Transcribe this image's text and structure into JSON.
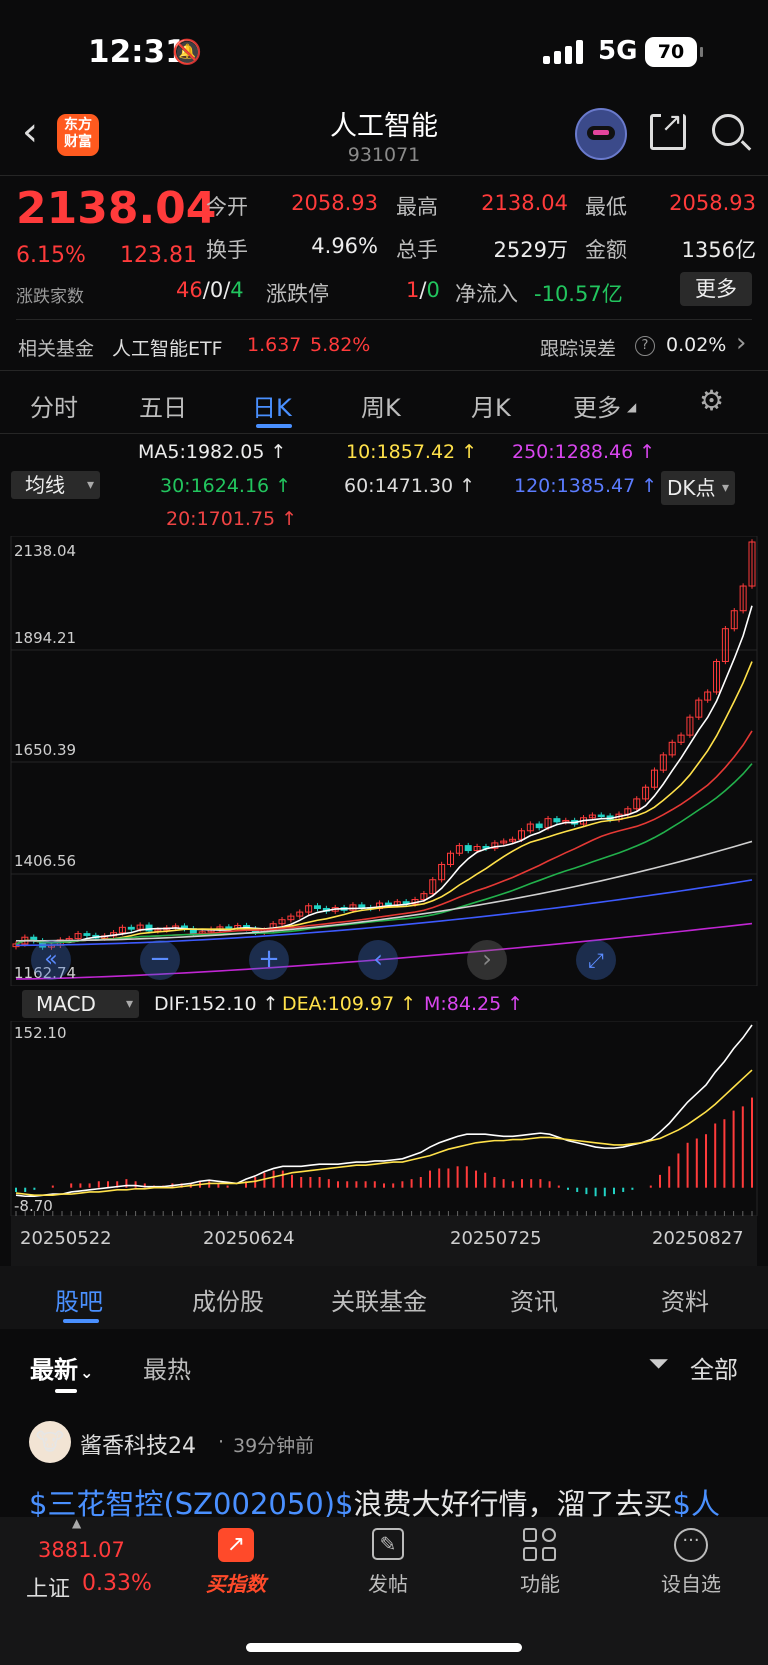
{
  "status_bar": {
    "time": "12:31",
    "network": "5G",
    "battery": "70"
  },
  "header": {
    "logo_text": "东方财富",
    "title": "人工智能",
    "code": "931071"
  },
  "quote": {
    "price": "2138.04",
    "pct": "6.15%",
    "change": "123.81",
    "open_label": "今开",
    "open": "2058.93",
    "high_label": "最高",
    "high": "2138.04",
    "low_label": "最低",
    "low": "2058.93",
    "turnover_label": "换手",
    "turnover": "4.96%",
    "volume_label": "总手",
    "volume": "2529万",
    "amount_label": "金额",
    "amount": "1356亿",
    "breadth_label": "涨跌家数",
    "breadth_up": "46",
    "breadth_flat": "0",
    "breadth_down": "4",
    "limit_label": "涨跌停",
    "limit_up": "1",
    "limit_down": "0",
    "netflow_label": "净流入",
    "netflow": "-10.57亿",
    "more_label": "更多",
    "slash": "/"
  },
  "fund": {
    "label": "相关基金",
    "name": "人工智能ETF",
    "price": "1.637",
    "pct": "5.82%",
    "track_label": "跟踪误差",
    "track_value": "0.02%",
    "help": "?",
    "arrow": "›"
  },
  "chart_tabs": [
    "分时",
    "五日",
    "日K",
    "周K",
    "月K",
    "更多"
  ],
  "active_chart_tab": 2,
  "ma_bar": {
    "select": "均线",
    "dk": "DK点",
    "ma5": "MA5:1982.05 ↑",
    "ma10": "10:1857.42 ↑",
    "ma250": "250:1288.46 ↑",
    "ma30": "30:1624.16 ↑",
    "ma60": "60:1471.30 ↑",
    "ma120": "120:1385.47 ↑",
    "ma20": "20:1701.75 ↑"
  },
  "price_axis": [
    "2138.04",
    "1894.21",
    "1650.39",
    "1406.56",
    "1162.74"
  ],
  "macd_bar": {
    "select": "MACD",
    "dif": "DIF:152.10 ↑",
    "dea": "DEA:109.97 ↑",
    "m": "M:84.25 ↑"
  },
  "macd_axis": {
    "top": "152.10",
    "bottom": "-8.70"
  },
  "dates": [
    "20250522",
    "20250624",
    "20250725",
    "20250827"
  ],
  "colors": {
    "up": "#ff3b3b",
    "down": "#22d3c5",
    "ma5": "#ffffff",
    "ma10": "#ffe14a",
    "ma20": "#e53935",
    "ma30": "#22b14c",
    "ma60": "#d0d0d0",
    "ma120": "#3d5afe",
    "ma250": "#c026d3"
  },
  "chart_data": {
    "type": "candlestick",
    "ylim": [
      1162.74,
      2138.04
    ],
    "closes": [
      1243,
      1258,
      1250,
      1236,
      1240,
      1252,
      1255,
      1266,
      1262,
      1256,
      1261,
      1268,
      1280,
      1276,
      1285,
      1272,
      1274,
      1279,
      1283,
      1277,
      1266,
      1270,
      1276,
      1281,
      1278,
      1284,
      1277,
      1269,
      1274,
      1288,
      1297,
      1305,
      1314,
      1328,
      1322,
      1316,
      1324,
      1318,
      1330,
      1324,
      1322,
      1334,
      1330,
      1337,
      1332,
      1342,
      1355,
      1386,
      1420,
      1445,
      1462,
      1451,
      1460,
      1456,
      1468,
      1472,
      1476,
      1495,
      1510,
      1502,
      1522,
      1515,
      1518,
      1510,
      1524,
      1530,
      1528,
      1520,
      1532,
      1544,
      1566,
      1592,
      1630,
      1664,
      1692,
      1708,
      1748,
      1786,
      1804,
      1872,
      1945,
      1985,
      2040,
      2138.04
    ],
    "macd": {
      "ylim": [
        -8.7,
        152.1
      ],
      "dif": [
        -7,
        -8,
        -8,
        -7,
        -6,
        -6,
        -4,
        -3,
        -2,
        -1,
        0,
        1,
        2,
        2,
        1,
        1,
        1,
        2,
        3,
        4,
        6,
        7,
        6,
        5,
        4,
        8,
        11,
        15,
        18,
        20,
        20,
        20,
        21,
        22,
        22,
        22,
        23,
        24,
        24,
        25,
        25,
        26,
        27,
        30,
        33,
        38,
        42,
        45,
        48,
        50,
        50,
        50,
        49,
        48,
        48,
        49,
        50,
        51,
        50,
        47,
        44,
        42,
        40,
        38,
        37,
        37,
        38,
        40,
        42,
        45,
        52,
        60,
        70,
        80,
        88,
        96,
        108,
        118,
        130,
        140,
        152.1
      ],
      "dea": [
        -5,
        -6,
        -7,
        -7,
        -7,
        -6,
        -6,
        -5,
        -4,
        -4,
        -3,
        -2,
        -2,
        -1,
        -1,
        0,
        0,
        0,
        1,
        2,
        3,
        4,
        4,
        4,
        4,
        5,
        6,
        8,
        10,
        12,
        14,
        15,
        16,
        17,
        18,
        19,
        20,
        21,
        21,
        22,
        23,
        24,
        24,
        26,
        28,
        30,
        33,
        36,
        38,
        40,
        42,
        43,
        44,
        44,
        45,
        45,
        46,
        47,
        47,
        46,
        45,
        44,
        43,
        42,
        41,
        40,
        40,
        41,
        42,
        44,
        46,
        50,
        54,
        59,
        65,
        71,
        78,
        86,
        94,
        102,
        109.97
      ]
    }
  },
  "bottom_tabs": [
    "股吧",
    "成份股",
    "关联基金",
    "资讯",
    "资料"
  ],
  "feed_filters": {
    "latest": "最新",
    "hot": "最热",
    "all": "全部"
  },
  "post": {
    "user": "酱香科技24",
    "time": "39分钟前",
    "dot": "·",
    "text_link": "$三花智控(SZ002050)$",
    "text_plain": "浪费大好行情，溜了去买",
    "text_link2": "$人"
  },
  "bottom_nav": {
    "index_value": "3881.07",
    "index_name": "上证",
    "index_pct": "0.33%",
    "buy": "买指数",
    "post": "发帖",
    "func": "功能",
    "watch": "设自选"
  }
}
